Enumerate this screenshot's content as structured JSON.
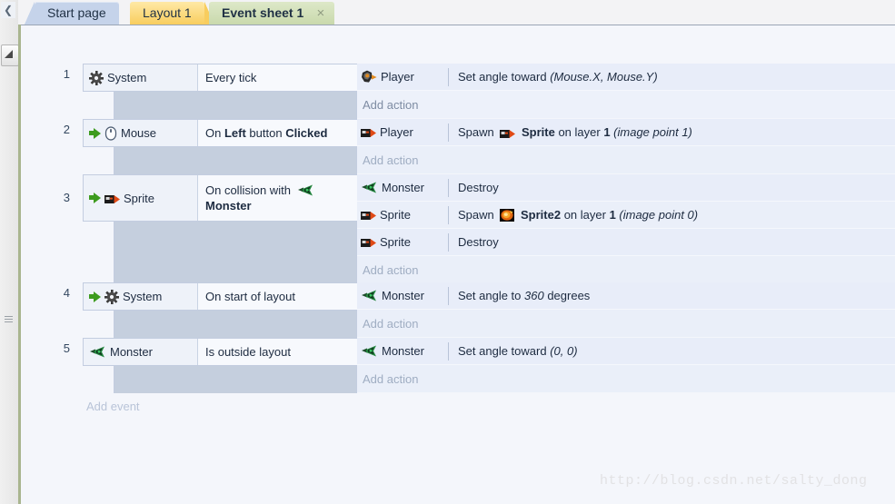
{
  "window": {
    "left_strip": {
      "collapse_icon": "chevron-left-icon",
      "tool_icon": "pointer-icon",
      "grip_icon": "grip-handle-icon"
    }
  },
  "tabs": [
    {
      "label": "Start page",
      "active": false,
      "closable": false
    },
    {
      "label": "Layout 1",
      "active": false,
      "closable": false
    },
    {
      "label": "Event sheet 1",
      "active": true,
      "closable": true,
      "close_label": "×"
    }
  ],
  "event_sheet": {
    "add_event_label": "Add event",
    "add_action_label": "Add action",
    "events": [
      {
        "number": "1",
        "has_trigger_arrow": false,
        "object_icon": "system-gear-icon",
        "object": "System",
        "condition_prefix": "Every tick",
        "condition_bold": "",
        "condition_suffix": "",
        "actions": [
          {
            "object_icon": "player-sprite-icon",
            "object": "Player",
            "text_parts": [
              {
                "t": "Set angle toward ",
                "style": "normal"
              },
              {
                "t": "(Mouse.X, Mouse.Y)",
                "style": "italic"
              }
            ]
          }
        ]
      },
      {
        "number": "2",
        "has_trigger_arrow": true,
        "object_icon": "mouse-icon",
        "object": "Mouse",
        "condition_prefix": "On ",
        "condition_bold": "Left",
        "condition_mid": " button ",
        "condition_bold2": "Clicked",
        "actions": [
          {
            "object_icon": "sprite-icon",
            "object": "Player",
            "object_icon_name": "player-sprite-icon",
            "text_parts": [
              {
                "t": "Spawn ",
                "style": "normal"
              },
              {
                "t": "ICON:sprite-icon",
                "style": "icon"
              },
              {
                "t": "Sprite",
                "style": "bold"
              },
              {
                "t": " on layer ",
                "style": "normal"
              },
              {
                "t": "1",
                "style": "bold"
              },
              {
                "t": " (image point 1)",
                "style": "italic"
              }
            ]
          }
        ]
      },
      {
        "number": "3",
        "has_trigger_arrow": true,
        "object_icon": "sprite-icon",
        "object": "Sprite",
        "condition_prefix": "On collision with ",
        "condition_icon": "monster-icon",
        "condition_bold": "Monster",
        "actions": [
          {
            "object_icon": "monster-icon",
            "object": "Monster",
            "text_parts": [
              {
                "t": "Destroy",
                "style": "normal"
              }
            ]
          },
          {
            "object_icon": "sprite-icon",
            "object": "Sprite",
            "text_parts": [
              {
                "t": "Spawn ",
                "style": "normal"
              },
              {
                "t": "ICON:sprite2-icon",
                "style": "icon"
              },
              {
                "t": "Sprite2",
                "style": "bold"
              },
              {
                "t": " on layer ",
                "style": "normal"
              },
              {
                "t": "1",
                "style": "bold"
              },
              {
                "t": " (image point 0)",
                "style": "italic"
              }
            ]
          },
          {
            "object_icon": "sprite-icon",
            "object": "Sprite",
            "text_parts": [
              {
                "t": "Destroy",
                "style": "normal"
              }
            ]
          }
        ]
      },
      {
        "number": "4",
        "has_trigger_arrow": true,
        "object_icon": "system-gear-icon",
        "object": "System",
        "condition_prefix": "On start of layout",
        "actions": [
          {
            "object_icon": "monster-icon",
            "object": "Monster",
            "text_parts": [
              {
                "t": "Set angle to ",
                "style": "normal"
              },
              {
                "t": "360",
                "style": "italic"
              },
              {
                "t": " degrees",
                "style": "normal"
              }
            ]
          }
        ]
      },
      {
        "number": "5",
        "has_trigger_arrow": false,
        "object_icon": "monster-icon",
        "object": "Monster",
        "condition_prefix": "Is outside layout",
        "actions": [
          {
            "object_icon": "monster-icon",
            "object": "Monster",
            "text_parts": [
              {
                "t": "Set angle toward ",
                "style": "normal"
              },
              {
                "t": "(0, 0)",
                "style": "italic"
              }
            ]
          }
        ]
      }
    ]
  },
  "watermark": {
    "text": "http://blog.csdn.net/salty_dong"
  },
  "colors": {
    "tab_start": "#c5d3ea",
    "tab_layout": "#f8cd5e",
    "tab_event": "#c9d9ac",
    "sheet_bg": "#f4f6fb",
    "condition_bg": "#f7f9fd",
    "action_bg": "#e8edf9",
    "filler": "#c5cfde",
    "arrow_green": "#3d9b1e"
  }
}
